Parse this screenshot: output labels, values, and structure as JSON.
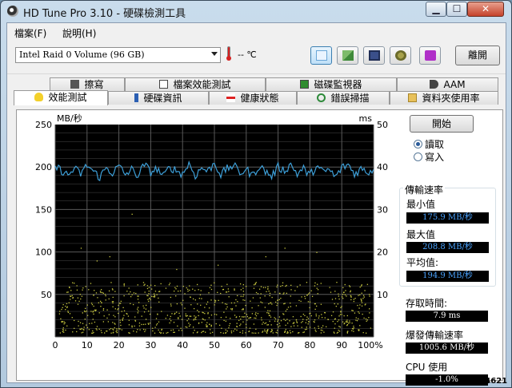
{
  "window": {
    "title": "HD Tune Pro 3.10 - 硬碟檢測工具"
  },
  "menu": [
    {
      "label": "檔案(F)"
    },
    {
      "label": "說明(H)"
    }
  ],
  "toolbar": {
    "drive": "Intel   Raid 0 Volume (96 GB)",
    "temperature": "-- ℃",
    "exit_label": "離開",
    "icons": [
      "screenshot-icon",
      "copy-icon",
      "save-icon",
      "options-icon",
      "download-icon"
    ]
  },
  "tabs_top": [
    {
      "label": "擦寫",
      "icon": "trash-icon"
    },
    {
      "label": "檔案效能測試",
      "icon": "file-icon"
    },
    {
      "label": "磁碟監視器",
      "icon": "monitor-icon"
    },
    {
      "label": "AAM",
      "icon": "speaker-icon"
    }
  ],
  "tabs_bottom": [
    {
      "label": "效能測試",
      "icon": "bulb-icon",
      "selected": true
    },
    {
      "label": "硬碟資訊",
      "icon": "info-icon"
    },
    {
      "label": "健康狀態",
      "icon": "health-cross-icon"
    },
    {
      "label": "錯誤掃描",
      "icon": "magnifier-icon"
    },
    {
      "label": "資料夾使用率",
      "icon": "folder-icon"
    }
  ],
  "controls": {
    "start_label": "開始",
    "read_label": "讀取",
    "write_label": "寫入",
    "selected_mode": "read"
  },
  "results": {
    "group_title": "傳輸速率",
    "min_label": "最小值",
    "min_value": "175.9 MB/秒",
    "max_label": "最大值",
    "max_value": "208.8 MB/秒",
    "avg_label": "平均值:",
    "avg_value": "194.9 MB/秒",
    "access_label": "存取時間:",
    "access_value": "7.9 ms",
    "burst_label": "爆發傳輸速率",
    "burst_value": "1005.6 MB/秒",
    "cpu_label": "CPU 使用",
    "cpu_value": "-1.0%"
  },
  "chart_data": {
    "type": "line",
    "ylabel_left": "MB/秒",
    "ylabel_right": "ms",
    "ylim_left": [
      0,
      250
    ],
    "ylim_right": [
      0,
      50
    ],
    "xlim": [
      0,
      100
    ],
    "x_ticks": [
      "0",
      "10",
      "20",
      "30",
      "40",
      "50",
      "60",
      "70",
      "80",
      "90",
      "100%"
    ],
    "y_ticks_left": [
      "250",
      "200",
      "150",
      "100",
      "50"
    ],
    "y_ticks_right": [
      "50",
      "40",
      "30",
      "20",
      "10"
    ],
    "grid": true,
    "colors": {
      "background": "#000000",
      "grid": "#5a5a5a",
      "transfer": "#3d9fd8",
      "access": "#c8c840"
    },
    "series": [
      {
        "name": "transfer rate",
        "axis": "left",
        "x": [
          0,
          2,
          4,
          6,
          8,
          10,
          12,
          14,
          16,
          18,
          20,
          22,
          24,
          26,
          28,
          30,
          32,
          34,
          36,
          38,
          40,
          42,
          44,
          46,
          48,
          50,
          52,
          54,
          56,
          58,
          60,
          62,
          64,
          66,
          68,
          70,
          72,
          74,
          76,
          78,
          80,
          82,
          84,
          86,
          88,
          90,
          92,
          94,
          96,
          98,
          100
        ],
        "values": [
          200,
          196,
          190,
          198,
          192,
          202,
          195,
          188,
          199,
          193,
          201,
          191,
          197,
          190,
          203,
          194,
          198,
          189,
          200,
          196,
          192,
          204,
          190,
          199,
          195,
          205,
          191,
          198,
          202,
          193,
          197,
          190,
          201,
          195,
          189,
          200,
          196,
          203,
          192,
          198,
          190,
          201,
          194,
          197,
          188,
          199,
          203,
          192,
          198,
          194,
          197
        ]
      },
      {
        "name": "access time",
        "axis": "right",
        "type": "scatter",
        "note_range_ms": [
          1,
          13
        ],
        "x_min": 1,
        "x_max": 99
      }
    ]
  },
  "watermark": "#104621"
}
